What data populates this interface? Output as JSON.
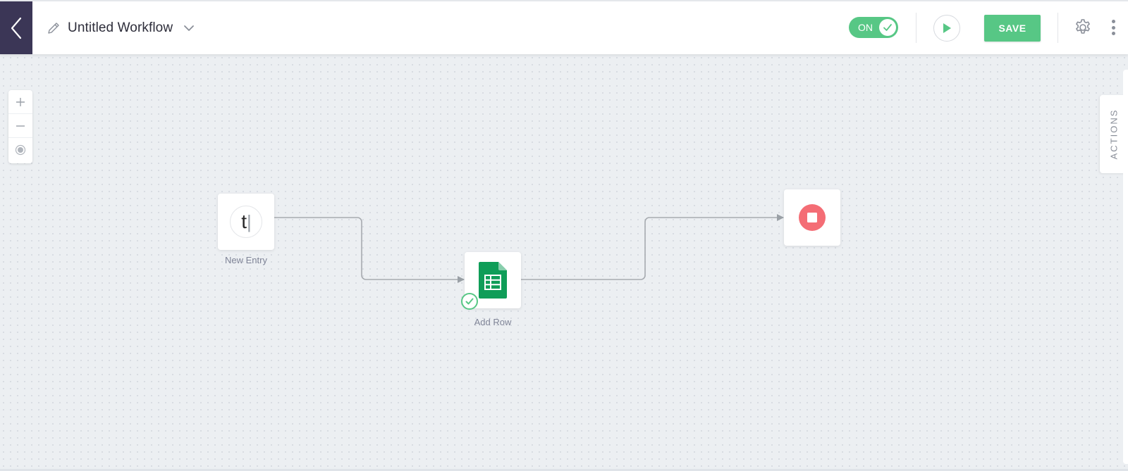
{
  "header": {
    "workflow_title": "Untitled Workflow",
    "toggle_label": "ON",
    "save_label": "SAVE"
  },
  "canvas": {
    "actions_tab_label": "ACTIONS",
    "nodes": {
      "trigger": {
        "label": "New Entry",
        "glyph": "t"
      },
      "action": {
        "label": "Add Row"
      },
      "end": {
        "label": ""
      }
    }
  },
  "colors": {
    "brand_dark": "#3b3656",
    "accent_green": "#57c785",
    "stop_red": "#f46d75",
    "sheets_green": "#0f9d58"
  },
  "icons": {
    "back": "chevron-left-icon",
    "edit": "pencil-icon",
    "dropdown": "chevron-down-icon",
    "toggle_check": "check-icon",
    "run": "play-icon",
    "settings": "gear-icon",
    "more": "more-vertical-icon",
    "zoom_in": "plus-icon",
    "zoom_out": "minus-icon",
    "recenter": "target-icon",
    "stop": "stop-icon",
    "sheets": "google-sheets-icon",
    "status_ok": "check-circle-icon"
  }
}
